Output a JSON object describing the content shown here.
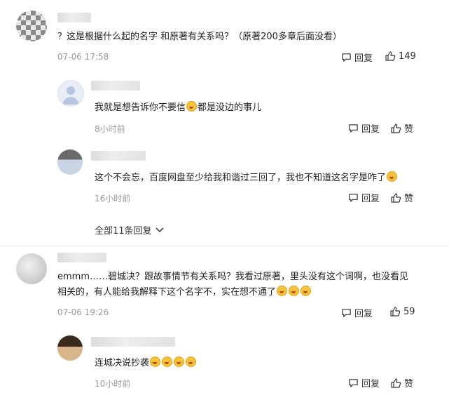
{
  "comments": [
    {
      "text": "？这是根据什么起的名字 和原著有关系吗？（原著200多章后面没看）",
      "time": "07-06 17:58",
      "reply_label": "回复",
      "like_count": "149",
      "replies": [
        {
          "text": "我就是想告诉你不要信",
          "text_after": "都是没边的事儿",
          "time": "8小时前",
          "reply_label": "回复",
          "like_label": "赞"
        },
        {
          "text": "这个不会忘，百度网盘至少给我和谐过三回了，我也不知道这名字是咋了",
          "time": "16小时前",
          "reply_label": "回复",
          "like_label": "赞"
        }
      ],
      "all_replies_label": "全部11条回复"
    },
    {
      "text_line1": "emmm……碧城决？跟故事情节有关系吗？我看过原著，里头没有这个词啊，也没看见",
      "text_line2": "相关的，有人能给我解释下这个名字不，实在想不通了",
      "time": "07-06 19:26",
      "reply_label": "回复",
      "like_count": "59",
      "replies": [
        {
          "text": "连城决说抄袭",
          "time": "10小时前",
          "reply_label": "回复",
          "like_label": "赞"
        }
      ]
    }
  ],
  "icons": {
    "reply": "comment-bubble-icon",
    "like": "thumbs-up-icon",
    "expand": "chevron-down-icon",
    "emoji": "laughing-crying-emoji-icon"
  },
  "colors": {
    "meta": "#9a9a9a",
    "text": "#222222",
    "divider": "#ececec"
  }
}
